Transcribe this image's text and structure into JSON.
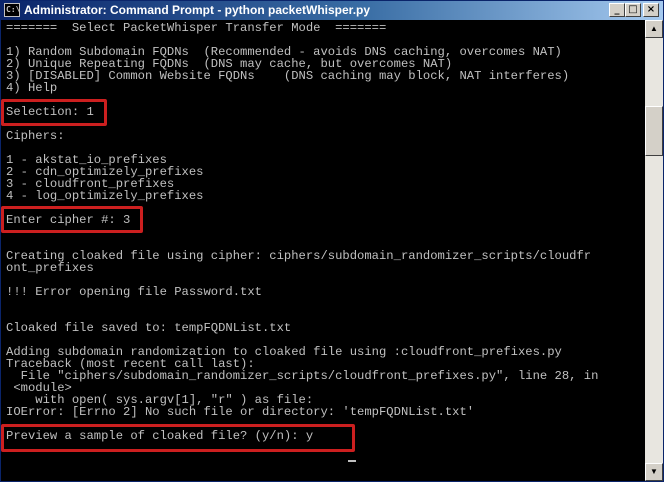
{
  "window": {
    "title": "Administrator: Command Prompt - python  packetWhisper.py",
    "icon": "cmd-prompt-icon",
    "controls": {
      "minimize": "minimize-icon",
      "maximize": "maximize-icon",
      "close": "close-icon"
    }
  },
  "console": {
    "lines": [
      "=======  Select PacketWhisper Transfer Mode  =======",
      "",
      "1) Random Subdomain FQDNs  (Recommended - avoids DNS caching, overcomes NAT)",
      "2) Unique Repeating FQDNs  (DNS may cache, but overcomes NAT)",
      "3) [DISABLED] Common Website FQDNs    (DNS caching may block, NAT interferes)",
      "4) Help",
      "",
      "Selection: 1",
      "",
      "Ciphers:",
      "",
      "1 - akstat_io_prefixes",
      "2 - cdn_optimizely_prefixes",
      "3 - cloudfront_prefixes",
      "4 - log_optimizely_prefixes",
      "",
      "Enter cipher #: 3",
      "",
      "",
      "Creating cloaked file using cipher: ciphers/subdomain_randomizer_scripts/cloudfr",
      "ont_prefixes",
      "",
      "!!! Error opening file Password.txt",
      "",
      "",
      "Cloaked file saved to: tempFQDNList.txt",
      "",
      "Adding subdomain randomization to cloaked file using :cloudfront_prefixes.py",
      "Traceback (most recent call last):",
      "  File \"ciphers/subdomain_randomizer_scripts/cloudfront_prefixes.py\", line 28, in",
      " <module>",
      "    with open( sys.argv[1], \"r\" ) as file:",
      "IOError: [Errno 2] No such file or directory: 'tempFQDNList.txt'",
      "",
      "Preview a sample of cloaked file? (y/n): y"
    ]
  },
  "colors": {
    "console_bg": "#000000",
    "console_text": "#c0c0c0",
    "highlight_border": "#cc1f1f",
    "titlebar_start": "#0a246a",
    "titlebar_end": "#a6caf0"
  }
}
